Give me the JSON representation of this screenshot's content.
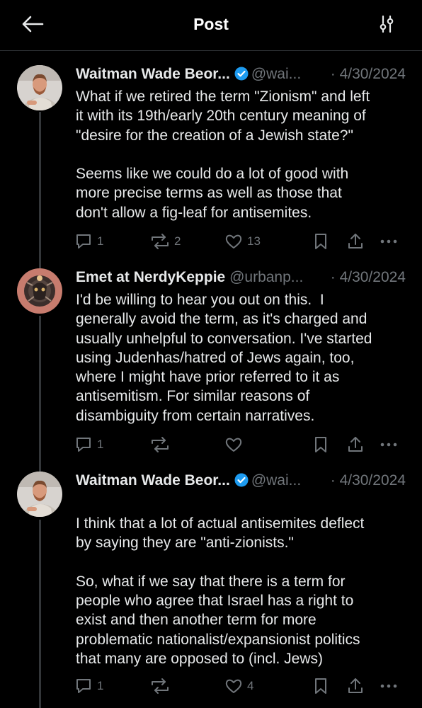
{
  "header": {
    "title": "Post",
    "back_icon": "arrow-left-icon",
    "filter_icon": "sliders-icon"
  },
  "colors": {
    "background": "#000000",
    "text": "#e7e9ea",
    "secondary_text": "#71767b",
    "verified": "#1d9bf0",
    "thread_line": "#333639"
  },
  "posts": [
    {
      "author": "Waitman Wade Beor...",
      "handle": "@wai...",
      "separator": "·",
      "date": "4/30/2024",
      "verified": true,
      "text": "What if we retired the term \"Zionism\" and left\nit with its 19th/early 20th century meaning of\n\"desire for the creation of a Jewish state?\"\n\nSeems like we could do a lot of good with\nmore precise terms as well as those that\ndon't allow a fig-leaf for antisemites.",
      "replies": "1",
      "reposts": "2",
      "likes": "13"
    },
    {
      "author": "Emet at NerdyKeppie",
      "handle": "@urbanp...",
      "separator": "·",
      "date": "4/30/2024",
      "verified": false,
      "text": "I'd be willing to hear you out on this.  I\ngenerally avoid the term, as it's charged and\nusually unhelpful to conversation. I've started\nusing Judenhas/hatred of Jews again, too,\nwhere I might have prior referred to it as\nantisemitism. For similar reasons of\ndisambiguity from certain narratives.",
      "replies": "1",
      "reposts": "",
      "likes": ""
    },
    {
      "author": "Waitman Wade Beor...",
      "handle": "@wai...",
      "separator": "·",
      "date": "4/30/2024",
      "verified": true,
      "text": "I think that a lot of actual antisemites deflect\nby saying they are \"anti-zionists.\"\n\nSo, what if we say that there is a term for\npeople who agree that Israel has a right to\nexist and then another term for more\nproblematic nationalist/expansionist politics\nthat many are opposed to (incl. Jews)",
      "replies": "1",
      "reposts": "",
      "likes": "4"
    }
  ]
}
